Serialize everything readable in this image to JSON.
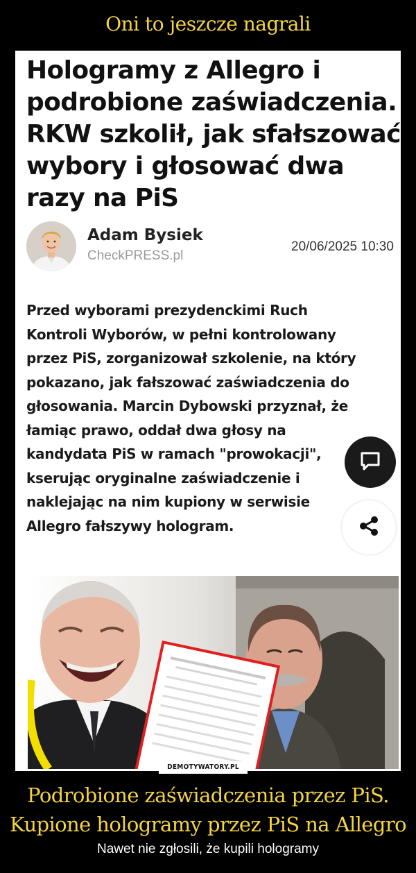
{
  "meme": {
    "top_title": "Oni to jeszcze nagrali",
    "bottom_title": "Podrobione zaświadczenia przez PiS.\nKupione hologramy przez PiS na Allegro",
    "subtitle": "Nawet nie zgłosili, że kupili hologramy",
    "watermark": "DEMOTYWATORY.PL",
    "title_color": "#f5d442"
  },
  "article": {
    "headline": "Hologramy z Allegro i\npodrobione zaświadczenia.\nRKW szkolił, jak sfałszować\nwybory i głosować dwa\nrazy na PiS",
    "author": {
      "name": "Adam Bysiek",
      "source": "CheckPRESS.pl",
      "avatar": "author-portrait"
    },
    "date": "20/06/2025 10:30",
    "lead": "Przed wyborami prezydenckimi Ruch\nKontroli Wyborów, w pełni kontrolowany\nprzez PiS, zorganizował szkolenie, na który\npokazano, jak fałszować zaświadczenia do\ngłosowania. Marcin Dybowski przyznał, że\nłamiąc prawo, oddał dwa głosy na\nkandydata PiS w ramach \"prowokacji\",\nkserując oryginalne zaświadczenie i\nnaklejając na nim kupiony w serwisie\nAllegro fałszywy hologram.",
    "actions": {
      "comment_icon": "comment-icon",
      "share_icon": "share-icon"
    },
    "photo": "two-men-with-certificate-photo"
  }
}
